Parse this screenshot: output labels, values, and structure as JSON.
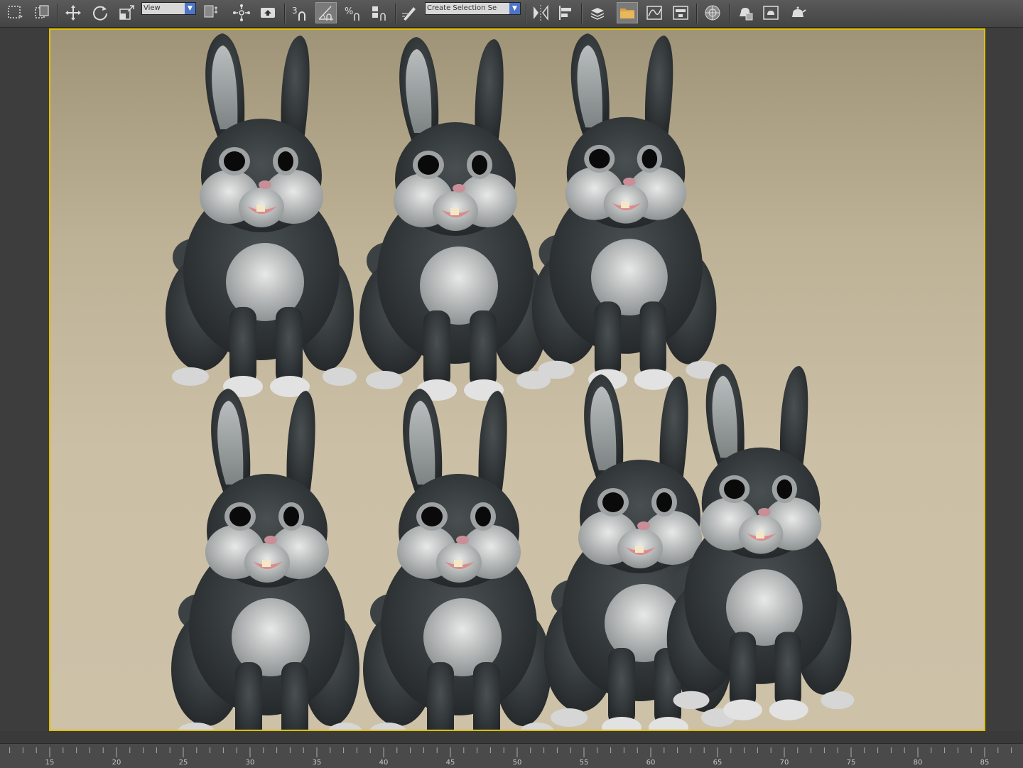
{
  "toolbar": {
    "tools": [
      {
        "name": "select-region-icon"
      },
      {
        "name": "select-object-icon"
      },
      {
        "name": "move-icon"
      },
      {
        "name": "rotate-icon"
      },
      {
        "name": "scale-icon"
      },
      {
        "name": "use-pivot-icon"
      },
      {
        "name": "select-and-manipulate-icon"
      },
      {
        "name": "keyboard-shortcut-icon"
      },
      {
        "name": "snap-3d-icon"
      },
      {
        "name": "angle-snap-icon"
      },
      {
        "name": "percent-snap-icon"
      },
      {
        "name": "spinner-snap-icon"
      },
      {
        "name": "edit-named-selection-icon"
      },
      {
        "name": "mirror-icon"
      },
      {
        "name": "align-icon"
      },
      {
        "name": "layer-manager-icon"
      },
      {
        "name": "scene-explorer-icon"
      },
      {
        "name": "curve-editor-icon"
      },
      {
        "name": "schematic-view-icon"
      },
      {
        "name": "material-editor-icon"
      },
      {
        "name": "render-setup-icon"
      },
      {
        "name": "rendered-frame-window-icon"
      },
      {
        "name": "render-production-icon"
      }
    ],
    "reference_coordinate_system": "View",
    "named_selection_set": "Create Selection Se"
  },
  "viewport": {
    "name": "perspective-viewport",
    "content": "rabbit-models"
  },
  "timeline": {
    "tick_labels": [
      "15",
      "20",
      "25",
      "30",
      "35",
      "40",
      "45",
      "50",
      "55",
      "60",
      "65",
      "70",
      "75",
      "80",
      "85"
    ]
  },
  "colors": {
    "active_viewport_border": "#e0c000",
    "dropdown_arrow": "#4d74c7"
  }
}
